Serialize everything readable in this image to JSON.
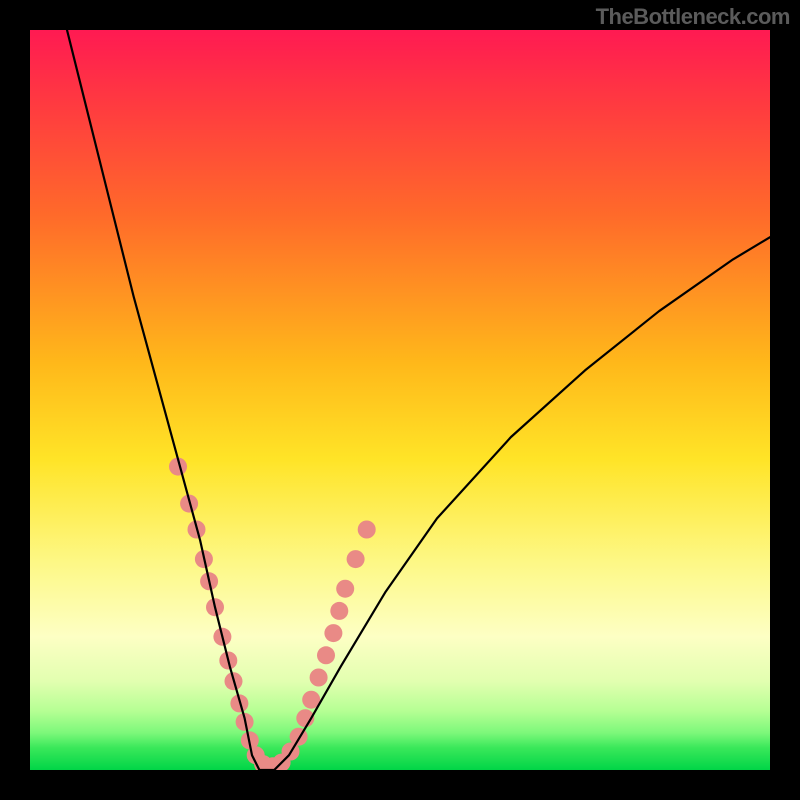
{
  "watermark": "TheBottleneck.com",
  "chart_data": {
    "type": "line",
    "title": "",
    "xlabel": "",
    "ylabel": "",
    "xlim": [
      0,
      100
    ],
    "ylim": [
      0,
      100
    ],
    "grid": false,
    "legend": false,
    "note": "V-shaped bottleneck curve over a red-to-green vertical gradient. Axes and ticks are not labeled; values approximate the visible shape.",
    "series": [
      {
        "name": "curve",
        "color": "#000000",
        "x": [
          5,
          8,
          11,
          14,
          17,
          20,
          23,
          25,
          27,
          29,
          30,
          31,
          33,
          35,
          38,
          42,
          48,
          55,
          65,
          75,
          85,
          95,
          100
        ],
        "y": [
          100,
          88,
          76,
          64,
          53,
          42,
          31,
          22,
          14,
          7,
          2,
          0,
          0,
          2,
          7,
          14,
          24,
          34,
          45,
          54,
          62,
          69,
          72
        ]
      }
    ],
    "markers": {
      "name": "dots",
      "color": "#e98a86",
      "radius": 9,
      "points": [
        {
          "x": 20.0,
          "y": 41.0
        },
        {
          "x": 21.5,
          "y": 36.0
        },
        {
          "x": 22.5,
          "y": 32.5
        },
        {
          "x": 23.5,
          "y": 28.5
        },
        {
          "x": 24.2,
          "y": 25.5
        },
        {
          "x": 25.0,
          "y": 22.0
        },
        {
          "x": 26.0,
          "y": 18.0
        },
        {
          "x": 26.8,
          "y": 14.8
        },
        {
          "x": 27.5,
          "y": 12.0
        },
        {
          "x": 28.3,
          "y": 9.0
        },
        {
          "x": 29.0,
          "y": 6.5
        },
        {
          "x": 29.7,
          "y": 4.0
        },
        {
          "x": 30.5,
          "y": 2.0
        },
        {
          "x": 31.5,
          "y": 0.8
        },
        {
          "x": 32.8,
          "y": 0.5
        },
        {
          "x": 34.0,
          "y": 1.0
        },
        {
          "x": 35.2,
          "y": 2.5
        },
        {
          "x": 36.3,
          "y": 4.5
        },
        {
          "x": 37.2,
          "y": 7.0
        },
        {
          "x": 38.0,
          "y": 9.5
        },
        {
          "x": 39.0,
          "y": 12.5
        },
        {
          "x": 40.0,
          "y": 15.5
        },
        {
          "x": 41.0,
          "y": 18.5
        },
        {
          "x": 41.8,
          "y": 21.5
        },
        {
          "x": 42.6,
          "y": 24.5
        },
        {
          "x": 44.0,
          "y": 28.5
        },
        {
          "x": 45.5,
          "y": 32.5
        }
      ]
    }
  }
}
